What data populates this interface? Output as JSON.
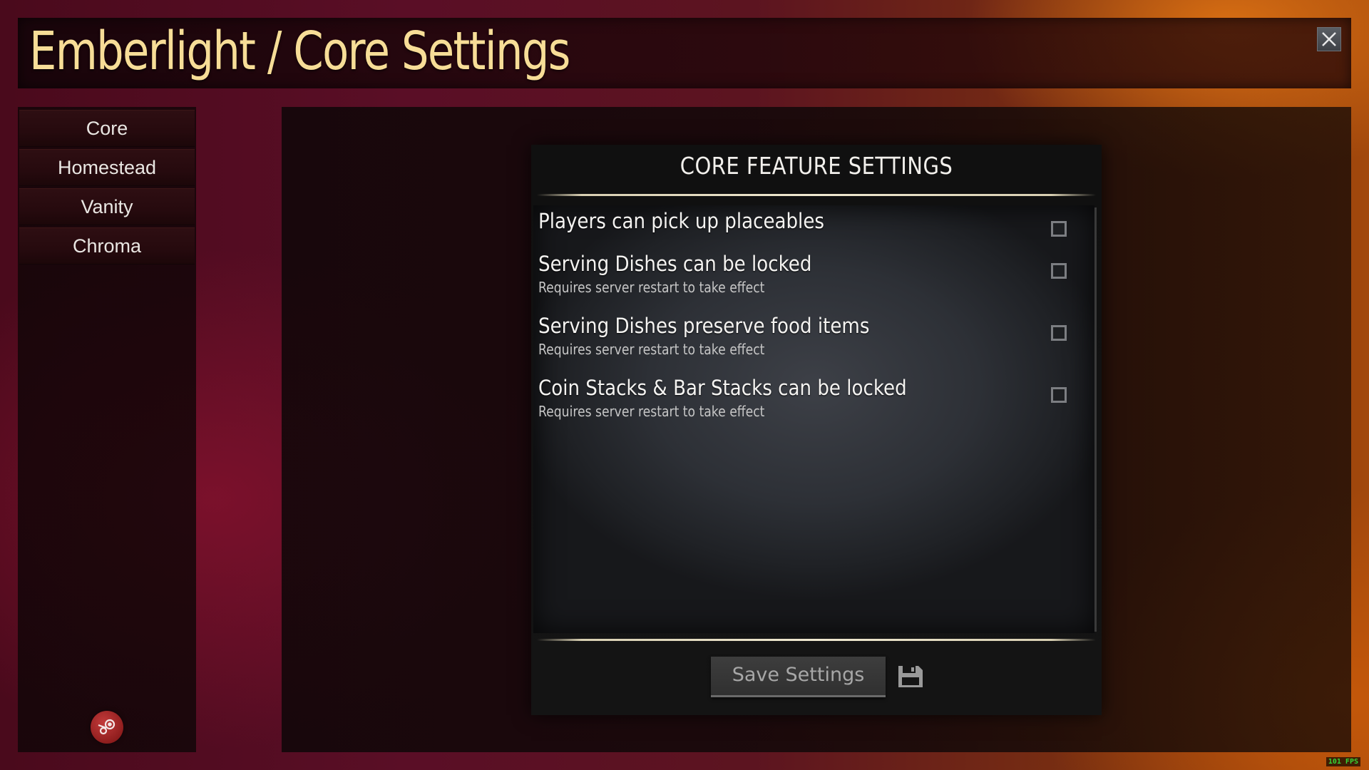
{
  "window": {
    "title": "Emberlight / Core Settings",
    "close_icon": "close-icon"
  },
  "sidebar": {
    "items": [
      {
        "label": "Core"
      },
      {
        "label": "Homestead"
      },
      {
        "label": "Vanity"
      },
      {
        "label": "Chroma"
      }
    ],
    "steam_icon": "steam-icon"
  },
  "panel": {
    "title": "CORE FEATURE SETTINGS",
    "options": [
      {
        "label": "Players can pick up placeables",
        "note": "",
        "checked": false
      },
      {
        "label": "Serving Dishes can be locked",
        "note": "Requires server restart to take effect",
        "checked": false
      },
      {
        "label": "Serving Dishes preserve food items",
        "note": "Requires server restart to take effect",
        "checked": false
      },
      {
        "label": "Coin Stacks & Bar Stacks can be locked",
        "note": "Requires server restart to take effect",
        "checked": false
      }
    ],
    "save_label": "Save Settings",
    "save_icon": "floppy-disk-icon"
  },
  "overlay": {
    "fps": "101 FPS"
  },
  "colors": {
    "title_text": "#f7dd97",
    "fps_text": "#36d536"
  }
}
